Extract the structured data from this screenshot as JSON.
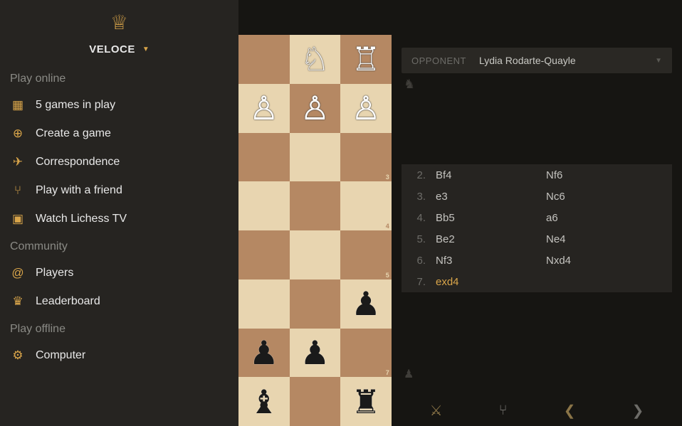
{
  "user": {
    "name": "VELOCE"
  },
  "sections": {
    "play_online": "Play online",
    "community": "Community",
    "play_offline": "Play offline"
  },
  "menu": {
    "games_in_play": "5 games in play",
    "create_game": "Create a game",
    "correspondence": "Correspondence",
    "play_friend": "Play with a friend",
    "watch_tv": "Watch Lichess TV",
    "players": "Players",
    "leaderboard": "Leaderboard",
    "computer": "Computer"
  },
  "opponent": {
    "label": "OPPONENT",
    "name": "Lydia Rodarte-Quayle"
  },
  "moves": [
    {
      "n": "2.",
      "w": "Bf4",
      "b": "Nf6"
    },
    {
      "n": "3.",
      "w": "e3",
      "b": "Nc6"
    },
    {
      "n": "4.",
      "w": "Bb5",
      "b": "a6"
    },
    {
      "n": "5.",
      "w": "Be2",
      "b": "Ne4"
    },
    {
      "n": "6.",
      "w": "Nf3",
      "b": "Nxd4"
    },
    {
      "n": "7.",
      "w": "exd4",
      "b": ""
    }
  ],
  "icons": {
    "crown": "♕",
    "grid": "▦",
    "plus": "⊕",
    "plane": "✈",
    "share": "⑂",
    "tv": "▣",
    "at": "@",
    "trophy": "♛",
    "gear": "⚙",
    "knight_dark": "♞",
    "pawn_dark": "♟",
    "swords": "⚔",
    "share2": "⑂",
    "prev": "❮",
    "next": "❯"
  },
  "pieces": {
    "wn": "♘",
    "wr": "♖",
    "wp": "♙",
    "bp": "♟",
    "bb": "♝",
    "br": "♜"
  }
}
